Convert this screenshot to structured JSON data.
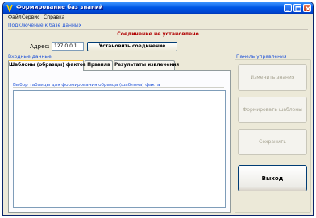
{
  "window": {
    "title": "Формирование баз знаний",
    "icon": "app-logo-icon"
  },
  "menu": {
    "items": [
      "Файл",
      "Сервис",
      "Справка"
    ]
  },
  "connection": {
    "group_label": "Подключение к базе данных",
    "status": "Соединение не установлено",
    "status_color": "#b00000",
    "address_label": "Адрес:",
    "address_value": "127.0.0.1",
    "connect_label": "Установить соединение"
  },
  "input": {
    "group_label": "Входные данные",
    "tabs": [
      {
        "label": "Шаблоны (образцы) фактов",
        "active": true
      },
      {
        "label": "Правила",
        "active": false
      },
      {
        "label": "Результаты извлечения",
        "active": false
      }
    ],
    "table_group_label": "Выбор таблицы для формирования образца (шаблона) факта"
  },
  "control_panel": {
    "group_label": "Панель управления",
    "buttons": {
      "edit": "Изменить знания",
      "form": "Формировать шаблоны",
      "save": "Сохранить",
      "exit": "Выход"
    }
  },
  "colors": {
    "titlebar": "#0058e6",
    "group_label": "#2154d8",
    "active_tab_accent": "#ffc83c"
  }
}
